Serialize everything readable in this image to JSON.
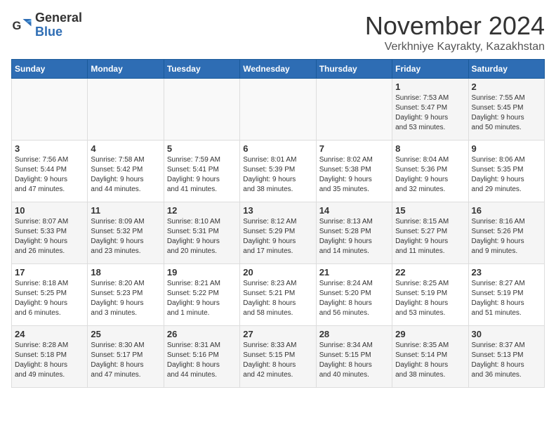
{
  "logo": {
    "general": "General",
    "blue": "Blue"
  },
  "header": {
    "month": "November 2024",
    "location": "Verkhniye Kayrakty, Kazakhstan"
  },
  "weekdays": [
    "Sunday",
    "Monday",
    "Tuesday",
    "Wednesday",
    "Thursday",
    "Friday",
    "Saturday"
  ],
  "weeks": [
    [
      {
        "day": "",
        "info": ""
      },
      {
        "day": "",
        "info": ""
      },
      {
        "day": "",
        "info": ""
      },
      {
        "day": "",
        "info": ""
      },
      {
        "day": "",
        "info": ""
      },
      {
        "day": "1",
        "info": "Sunrise: 7:53 AM\nSunset: 5:47 PM\nDaylight: 9 hours\nand 53 minutes."
      },
      {
        "day": "2",
        "info": "Sunrise: 7:55 AM\nSunset: 5:45 PM\nDaylight: 9 hours\nand 50 minutes."
      }
    ],
    [
      {
        "day": "3",
        "info": "Sunrise: 7:56 AM\nSunset: 5:44 PM\nDaylight: 9 hours\nand 47 minutes."
      },
      {
        "day": "4",
        "info": "Sunrise: 7:58 AM\nSunset: 5:42 PM\nDaylight: 9 hours\nand 44 minutes."
      },
      {
        "day": "5",
        "info": "Sunrise: 7:59 AM\nSunset: 5:41 PM\nDaylight: 9 hours\nand 41 minutes."
      },
      {
        "day": "6",
        "info": "Sunrise: 8:01 AM\nSunset: 5:39 PM\nDaylight: 9 hours\nand 38 minutes."
      },
      {
        "day": "7",
        "info": "Sunrise: 8:02 AM\nSunset: 5:38 PM\nDaylight: 9 hours\nand 35 minutes."
      },
      {
        "day": "8",
        "info": "Sunrise: 8:04 AM\nSunset: 5:36 PM\nDaylight: 9 hours\nand 32 minutes."
      },
      {
        "day": "9",
        "info": "Sunrise: 8:06 AM\nSunset: 5:35 PM\nDaylight: 9 hours\nand 29 minutes."
      }
    ],
    [
      {
        "day": "10",
        "info": "Sunrise: 8:07 AM\nSunset: 5:33 PM\nDaylight: 9 hours\nand 26 minutes."
      },
      {
        "day": "11",
        "info": "Sunrise: 8:09 AM\nSunset: 5:32 PM\nDaylight: 9 hours\nand 23 minutes."
      },
      {
        "day": "12",
        "info": "Sunrise: 8:10 AM\nSunset: 5:31 PM\nDaylight: 9 hours\nand 20 minutes."
      },
      {
        "day": "13",
        "info": "Sunrise: 8:12 AM\nSunset: 5:29 PM\nDaylight: 9 hours\nand 17 minutes."
      },
      {
        "day": "14",
        "info": "Sunrise: 8:13 AM\nSunset: 5:28 PM\nDaylight: 9 hours\nand 14 minutes."
      },
      {
        "day": "15",
        "info": "Sunrise: 8:15 AM\nSunset: 5:27 PM\nDaylight: 9 hours\nand 11 minutes."
      },
      {
        "day": "16",
        "info": "Sunrise: 8:16 AM\nSunset: 5:26 PM\nDaylight: 9 hours\nand 9 minutes."
      }
    ],
    [
      {
        "day": "17",
        "info": "Sunrise: 8:18 AM\nSunset: 5:25 PM\nDaylight: 9 hours\nand 6 minutes."
      },
      {
        "day": "18",
        "info": "Sunrise: 8:20 AM\nSunset: 5:23 PM\nDaylight: 9 hours\nand 3 minutes."
      },
      {
        "day": "19",
        "info": "Sunrise: 8:21 AM\nSunset: 5:22 PM\nDaylight: 9 hours\nand 1 minute."
      },
      {
        "day": "20",
        "info": "Sunrise: 8:23 AM\nSunset: 5:21 PM\nDaylight: 8 hours\nand 58 minutes."
      },
      {
        "day": "21",
        "info": "Sunrise: 8:24 AM\nSunset: 5:20 PM\nDaylight: 8 hours\nand 56 minutes."
      },
      {
        "day": "22",
        "info": "Sunrise: 8:25 AM\nSunset: 5:19 PM\nDaylight: 8 hours\nand 53 minutes."
      },
      {
        "day": "23",
        "info": "Sunrise: 8:27 AM\nSunset: 5:19 PM\nDaylight: 8 hours\nand 51 minutes."
      }
    ],
    [
      {
        "day": "24",
        "info": "Sunrise: 8:28 AM\nSunset: 5:18 PM\nDaylight: 8 hours\nand 49 minutes."
      },
      {
        "day": "25",
        "info": "Sunrise: 8:30 AM\nSunset: 5:17 PM\nDaylight: 8 hours\nand 47 minutes."
      },
      {
        "day": "26",
        "info": "Sunrise: 8:31 AM\nSunset: 5:16 PM\nDaylight: 8 hours\nand 44 minutes."
      },
      {
        "day": "27",
        "info": "Sunrise: 8:33 AM\nSunset: 5:15 PM\nDaylight: 8 hours\nand 42 minutes."
      },
      {
        "day": "28",
        "info": "Sunrise: 8:34 AM\nSunset: 5:15 PM\nDaylight: 8 hours\nand 40 minutes."
      },
      {
        "day": "29",
        "info": "Sunrise: 8:35 AM\nSunset: 5:14 PM\nDaylight: 8 hours\nand 38 minutes."
      },
      {
        "day": "30",
        "info": "Sunrise: 8:37 AM\nSunset: 5:13 PM\nDaylight: 8 hours\nand 36 minutes."
      }
    ]
  ]
}
